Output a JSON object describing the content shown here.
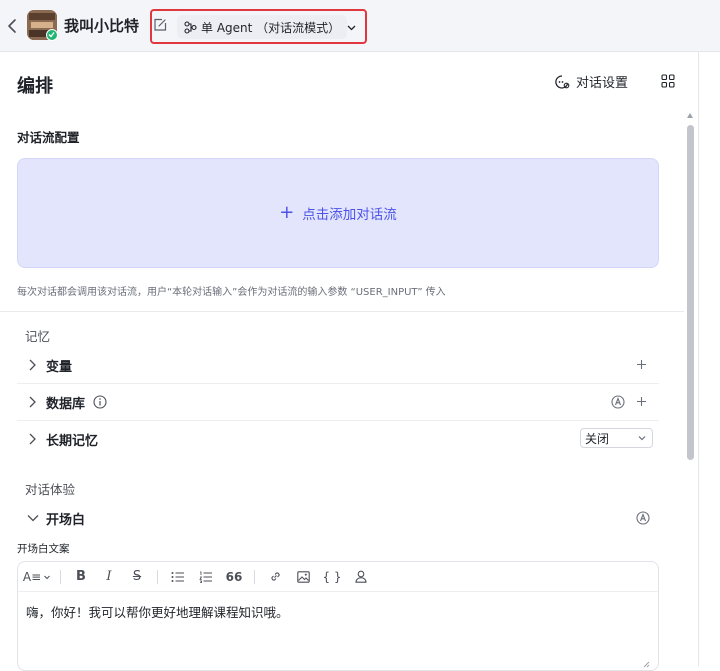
{
  "header": {
    "app_title": "我叫小比特",
    "mode_label": "单 Agent （对话流模式）"
  },
  "main": {
    "section_title": "编排",
    "dialog_settings_label": "对话设置",
    "flow": {
      "label": "对话流配置",
      "add_button": "点击添加对话流",
      "add_plus": "+",
      "hint": "每次对话都会调用该对话流，用户“本轮对话输入”会作为对话流的输入参数 “USER_INPUT” 传入"
    },
    "memory": {
      "group_label": "记忆",
      "items": [
        {
          "label": "变量"
        },
        {
          "label": "数据库"
        },
        {
          "label": "长期记忆"
        }
      ],
      "long_term_select_value": "关闭"
    },
    "experience": {
      "group_label": "对话体验",
      "opening": {
        "label": "开场白",
        "copy_label": "开场白文案",
        "text": "嗨，你好！我可以帮你更好地理解课程知识哦。"
      }
    }
  },
  "toolbar": {
    "heading_glyph": "A≡",
    "bold": "B",
    "italic": "I",
    "strike": "S",
    "quote": "66",
    "code": "{ }"
  },
  "colors": {
    "accent": "#4d53e8",
    "highlight_border": "#e0383e",
    "flow_bg": "#e3e5fd",
    "status_green": "#22b573"
  },
  "icons": [
    "back-icon",
    "edit-icon",
    "workflow-icon",
    "chevron-down-icon",
    "settings-chat-icon",
    "grid-icon",
    "chevron-right-icon",
    "info-icon",
    "auto-icon",
    "plus-icon",
    "link-icon",
    "image-icon",
    "user-icon"
  ]
}
